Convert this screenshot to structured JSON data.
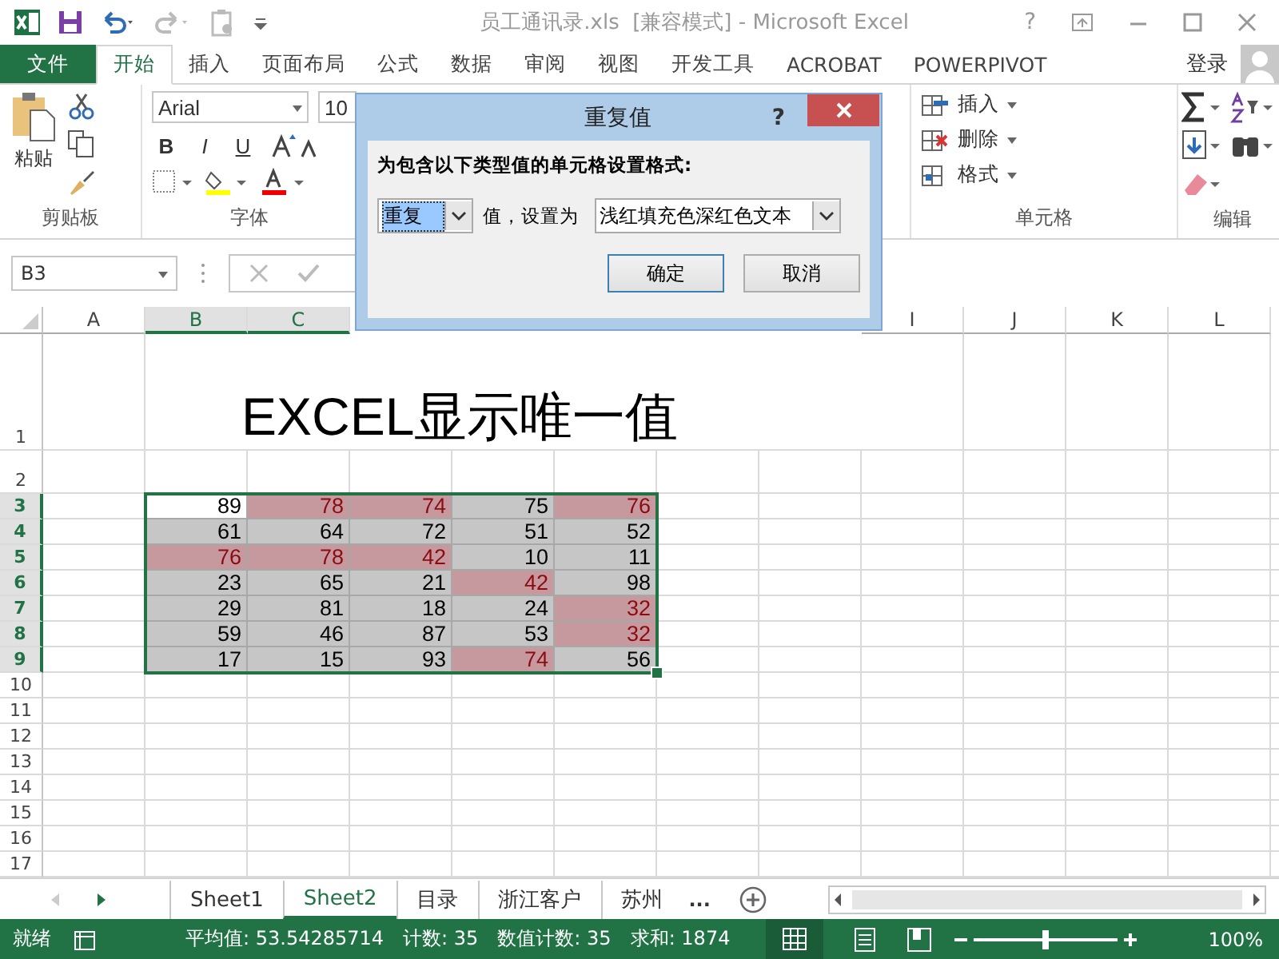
{
  "title_bar": {
    "title": "员工通讯录.xls  [兼容模式] - Microsoft Excel",
    "help": "?"
  },
  "tabs": [
    {
      "label": "文件",
      "kind": "file",
      "selected": false
    },
    {
      "label": "开始",
      "kind": "tab",
      "selected": true
    },
    {
      "label": "插入",
      "kind": "tab",
      "selected": false
    },
    {
      "label": "页面布局",
      "kind": "tab",
      "selected": false
    },
    {
      "label": "公式",
      "kind": "tab",
      "selected": false
    },
    {
      "label": "数据",
      "kind": "tab",
      "selected": false
    },
    {
      "label": "审阅",
      "kind": "tab",
      "selected": false
    },
    {
      "label": "视图",
      "kind": "tab",
      "selected": false
    },
    {
      "label": "开发工具",
      "kind": "tab",
      "selected": false
    },
    {
      "label": "ACROBAT",
      "kind": "tab",
      "selected": false
    },
    {
      "label": "POWERPIVOT",
      "kind": "tab",
      "selected": false
    }
  ],
  "account": {
    "label": "登录"
  },
  "ribbon": {
    "clipboard": {
      "label": "剪贴板",
      "paste": "粘贴"
    },
    "font": {
      "label": "字体",
      "font_name": "Arial",
      "font_size": "10",
      "bold": "B",
      "italic": "I",
      "underline": "U"
    },
    "cells": {
      "label": "单元格",
      "items": [
        "插入",
        "删除",
        "格式"
      ]
    },
    "editing": {
      "label": "编辑"
    }
  },
  "name_box": "B3",
  "dialog": {
    "title": "重复值",
    "help": "?",
    "prompt": "为包含以下类型值的单元格设置格式:",
    "type_value": "重复",
    "middle": "值，设置为",
    "format_value": "浅红填充色深红色文本",
    "ok": "确定",
    "cancel": "取消"
  },
  "columns": [
    {
      "label": "A",
      "selected": false
    },
    {
      "label": "B",
      "selected": true
    },
    {
      "label": "C",
      "selected": true
    },
    {},
    {},
    {},
    {},
    {},
    {
      "label": "I",
      "selected": false
    },
    {
      "label": "J",
      "selected": false
    },
    {
      "label": "K",
      "selected": false
    },
    {
      "label": "L",
      "selected": false
    }
  ],
  "rows": [
    {
      "label": "1",
      "selected": false,
      "title": "EXCEL显示唯一值"
    },
    {
      "label": "2",
      "selected": false
    },
    {
      "label": "3",
      "selected": true,
      "cells": [
        {
          "value": "89",
          "duplicate": false,
          "active": true
        },
        {
          "value": "78",
          "duplicate": true,
          "active": false
        },
        {
          "value": "74",
          "duplicate": true,
          "active": false
        },
        {
          "value": "75",
          "duplicate": false,
          "active": false
        },
        {
          "value": "76",
          "duplicate": true,
          "active": false
        }
      ]
    },
    {
      "label": "4",
      "selected": true,
      "cells": [
        {
          "value": "61",
          "duplicate": false,
          "active": false
        },
        {
          "value": "64",
          "duplicate": false,
          "active": false
        },
        {
          "value": "72",
          "duplicate": false,
          "active": false
        },
        {
          "value": "51",
          "duplicate": false,
          "active": false
        },
        {
          "value": "52",
          "duplicate": false,
          "active": false
        }
      ]
    },
    {
      "label": "5",
      "selected": true,
      "cells": [
        {
          "value": "76",
          "duplicate": true,
          "active": false
        },
        {
          "value": "78",
          "duplicate": true,
          "active": false
        },
        {
          "value": "42",
          "duplicate": true,
          "active": false
        },
        {
          "value": "10",
          "duplicate": false,
          "active": false
        },
        {
          "value": "11",
          "duplicate": false,
          "active": false
        }
      ]
    },
    {
      "label": "6",
      "selected": true,
      "cells": [
        {
          "value": "23",
          "duplicate": false,
          "active": false
        },
        {
          "value": "65",
          "duplicate": false,
          "active": false
        },
        {
          "value": "21",
          "duplicate": false,
          "active": false
        },
        {
          "value": "42",
          "duplicate": true,
          "active": false
        },
        {
          "value": "98",
          "duplicate": false,
          "active": false
        }
      ]
    },
    {
      "label": "7",
      "selected": true,
      "cells": [
        {
          "value": "29",
          "duplicate": false,
          "active": false
        },
        {
          "value": "81",
          "duplicate": false,
          "active": false
        },
        {
          "value": "18",
          "duplicate": false,
          "active": false
        },
        {
          "value": "24",
          "duplicate": false,
          "active": false
        },
        {
          "value": "32",
          "duplicate": true,
          "active": false
        }
      ]
    },
    {
      "label": "8",
      "selected": true,
      "cells": [
        {
          "value": "59",
          "duplicate": false,
          "active": false
        },
        {
          "value": "46",
          "duplicate": false,
          "active": false
        },
        {
          "value": "87",
          "duplicate": false,
          "active": false
        },
        {
          "value": "53",
          "duplicate": false,
          "active": false
        },
        {
          "value": "32",
          "duplicate": true,
          "active": false
        }
      ]
    },
    {
      "label": "9",
      "selected": true,
      "cells": [
        {
          "value": "17",
          "duplicate": false,
          "active": false
        },
        {
          "value": "15",
          "duplicate": false,
          "active": false
        },
        {
          "value": "93",
          "duplicate": false,
          "active": false
        },
        {
          "value": "74",
          "duplicate": true,
          "active": false
        },
        {
          "value": "56",
          "duplicate": false,
          "active": false
        }
      ]
    },
    {
      "label": "10",
      "selected": false
    },
    {
      "label": "11",
      "selected": false
    },
    {
      "label": "12",
      "selected": false
    },
    {
      "label": "13",
      "selected": false
    },
    {
      "label": "14",
      "selected": false
    },
    {
      "label": "15",
      "selected": false
    },
    {
      "label": "16",
      "selected": false
    },
    {
      "label": "17",
      "selected": false
    }
  ],
  "sheet_tabs": [
    {
      "label": "Sheet1",
      "selected": false
    },
    {
      "label": "Sheet2",
      "selected": true
    },
    {
      "label": "目录",
      "selected": false
    },
    {
      "label": "浙江客户",
      "selected": false
    },
    {
      "label": "苏州",
      "selected": false
    }
  ],
  "more_sheets": "...",
  "status_bar": {
    "state": "就绪",
    "stats": [
      "平均值: 53.54285714",
      "计数: 35",
      "数值计数: 35",
      "求和: 1874"
    ],
    "zoom": "100%",
    "zoom_slider": {
      "level": 0.5
    }
  }
}
